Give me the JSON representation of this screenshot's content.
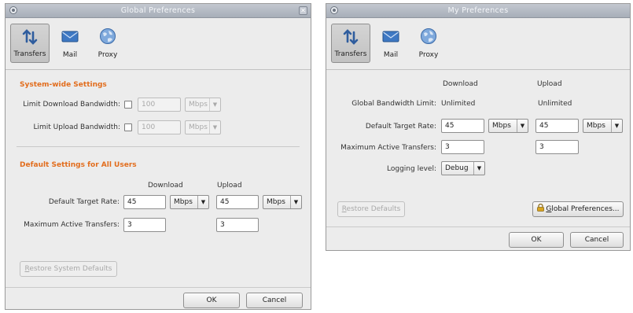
{
  "global": {
    "title": "Global Preferences",
    "tabs": [
      {
        "label": "Transfers"
      },
      {
        "label": "Mail"
      },
      {
        "label": "Proxy"
      }
    ],
    "system_section": "System-wide Settings",
    "limit_download_label": "Limit Download Bandwidth:",
    "limit_upload_label": "Limit Upload Bandwidth:",
    "limit_download_value": "100",
    "limit_upload_value": "100",
    "limit_unit": "Mbps",
    "defaults_section": "Default Settings for All Users",
    "download_header": "Download",
    "upload_header": "Upload",
    "target_rate_label": "Default Target Rate:",
    "target_rate_download": "45",
    "target_rate_upload": "45",
    "rate_unit": "Mbps",
    "max_active_label": "Maximum Active Transfers:",
    "max_active_download": "3",
    "max_active_upload": "3",
    "restore_label_first": "R",
    "restore_label_rest": "estore System Defaults",
    "ok_label": "OK",
    "cancel_label": "Cancel"
  },
  "mine": {
    "title": "My Preferences",
    "tabs": [
      {
        "label": "Transfers"
      },
      {
        "label": "Mail"
      },
      {
        "label": "Proxy"
      }
    ],
    "download_header": "Download",
    "upload_header": "Upload",
    "global_bw_label": "Global Bandwidth Limit:",
    "global_bw_download": "Unlimited",
    "global_bw_upload": "Unlimited",
    "target_rate_label": "Default Target Rate:",
    "target_rate_download": "45",
    "target_rate_upload": "45",
    "rate_unit": "Mbps",
    "max_active_label": "Maximum Active Transfers:",
    "max_active_download": "3",
    "max_active_upload": "3",
    "logging_label": "Logging level:",
    "logging_value": "Debug",
    "restore_label_first": "R",
    "restore_label_rest": "estore Defaults",
    "global_prefs_first": "G",
    "global_prefs_rest": "lobal Preferences...",
    "ok_label": "OK",
    "cancel_label": "Cancel"
  },
  "icons": {
    "transfers": "transfers-icon",
    "mail": "mail-icon",
    "proxy": "proxy-icon",
    "lock": "lock-icon"
  }
}
